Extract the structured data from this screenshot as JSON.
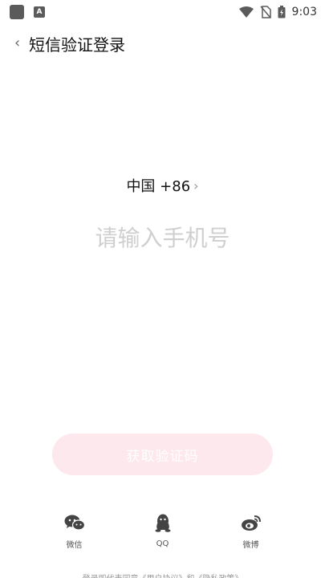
{
  "status_bar": {
    "time": "9:03",
    "icons": [
      "app-icon",
      "a-icon",
      "wifi-icon",
      "no-sim-icon",
      "battery-icon"
    ]
  },
  "header": {
    "back_icon": "chevron-left",
    "title": "短信验证登录"
  },
  "country": {
    "label": "中国 +86",
    "chevron": "›"
  },
  "phone": {
    "value": "",
    "placeholder": "请输入手机号"
  },
  "code_button": {
    "label": "获取验证码",
    "color": "#fde8ee"
  },
  "social": [
    {
      "label": "微信",
      "icon": "wechat-icon"
    },
    {
      "label": "QQ",
      "icon": "qq-icon"
    },
    {
      "label": "微博",
      "icon": "weibo-icon"
    }
  ],
  "agreement": {
    "text": "登录即代表同意《用户协议》和《隐私政策》"
  }
}
